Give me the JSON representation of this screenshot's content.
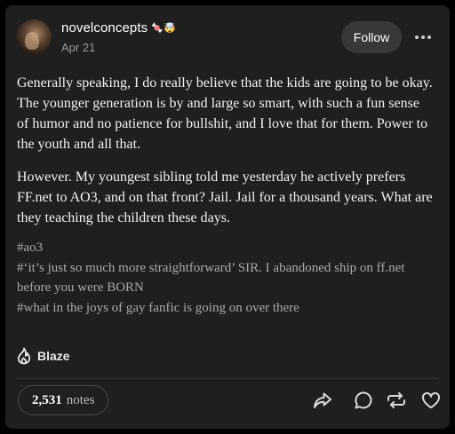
{
  "post": {
    "author": {
      "username": "novelconcepts",
      "badges": "🍬🤯",
      "avatar_icon": "avatar"
    },
    "date": "Apr 21",
    "follow_label": "Follow",
    "body": {
      "paragraphs": [
        "Generally speaking, I do really believe that the kids are going to be okay. The younger generation is by and large so smart, with such a fun sense of humor and no patience for bullshit, and I love that for them. Power to the youth and all that.",
        "However. My youngest sibling told me yesterday he actively prefers FF.net to AO3, and on that front? Jail. Jail for a thousand years. What are they teaching the children these days."
      ]
    },
    "tags": [
      "#ao3",
      "#‘it’s just so much more straightforward’ SIR. I abandoned ship on ff.net before you were BORN",
      "#what in the joys of gay fanfic is going on over there"
    ],
    "blaze_label": "Blaze",
    "notes": {
      "count": "2,531",
      "label": "notes"
    },
    "actions": [
      "share-icon",
      "reply-icon",
      "reblog-icon",
      "like-icon"
    ]
  },
  "colors": {
    "background": "#000000",
    "card": "#1f1f1f",
    "text": "#f2f2f2",
    "muted": "#9a9a9a",
    "tag": "#a9a9a9",
    "button": "#383838"
  }
}
